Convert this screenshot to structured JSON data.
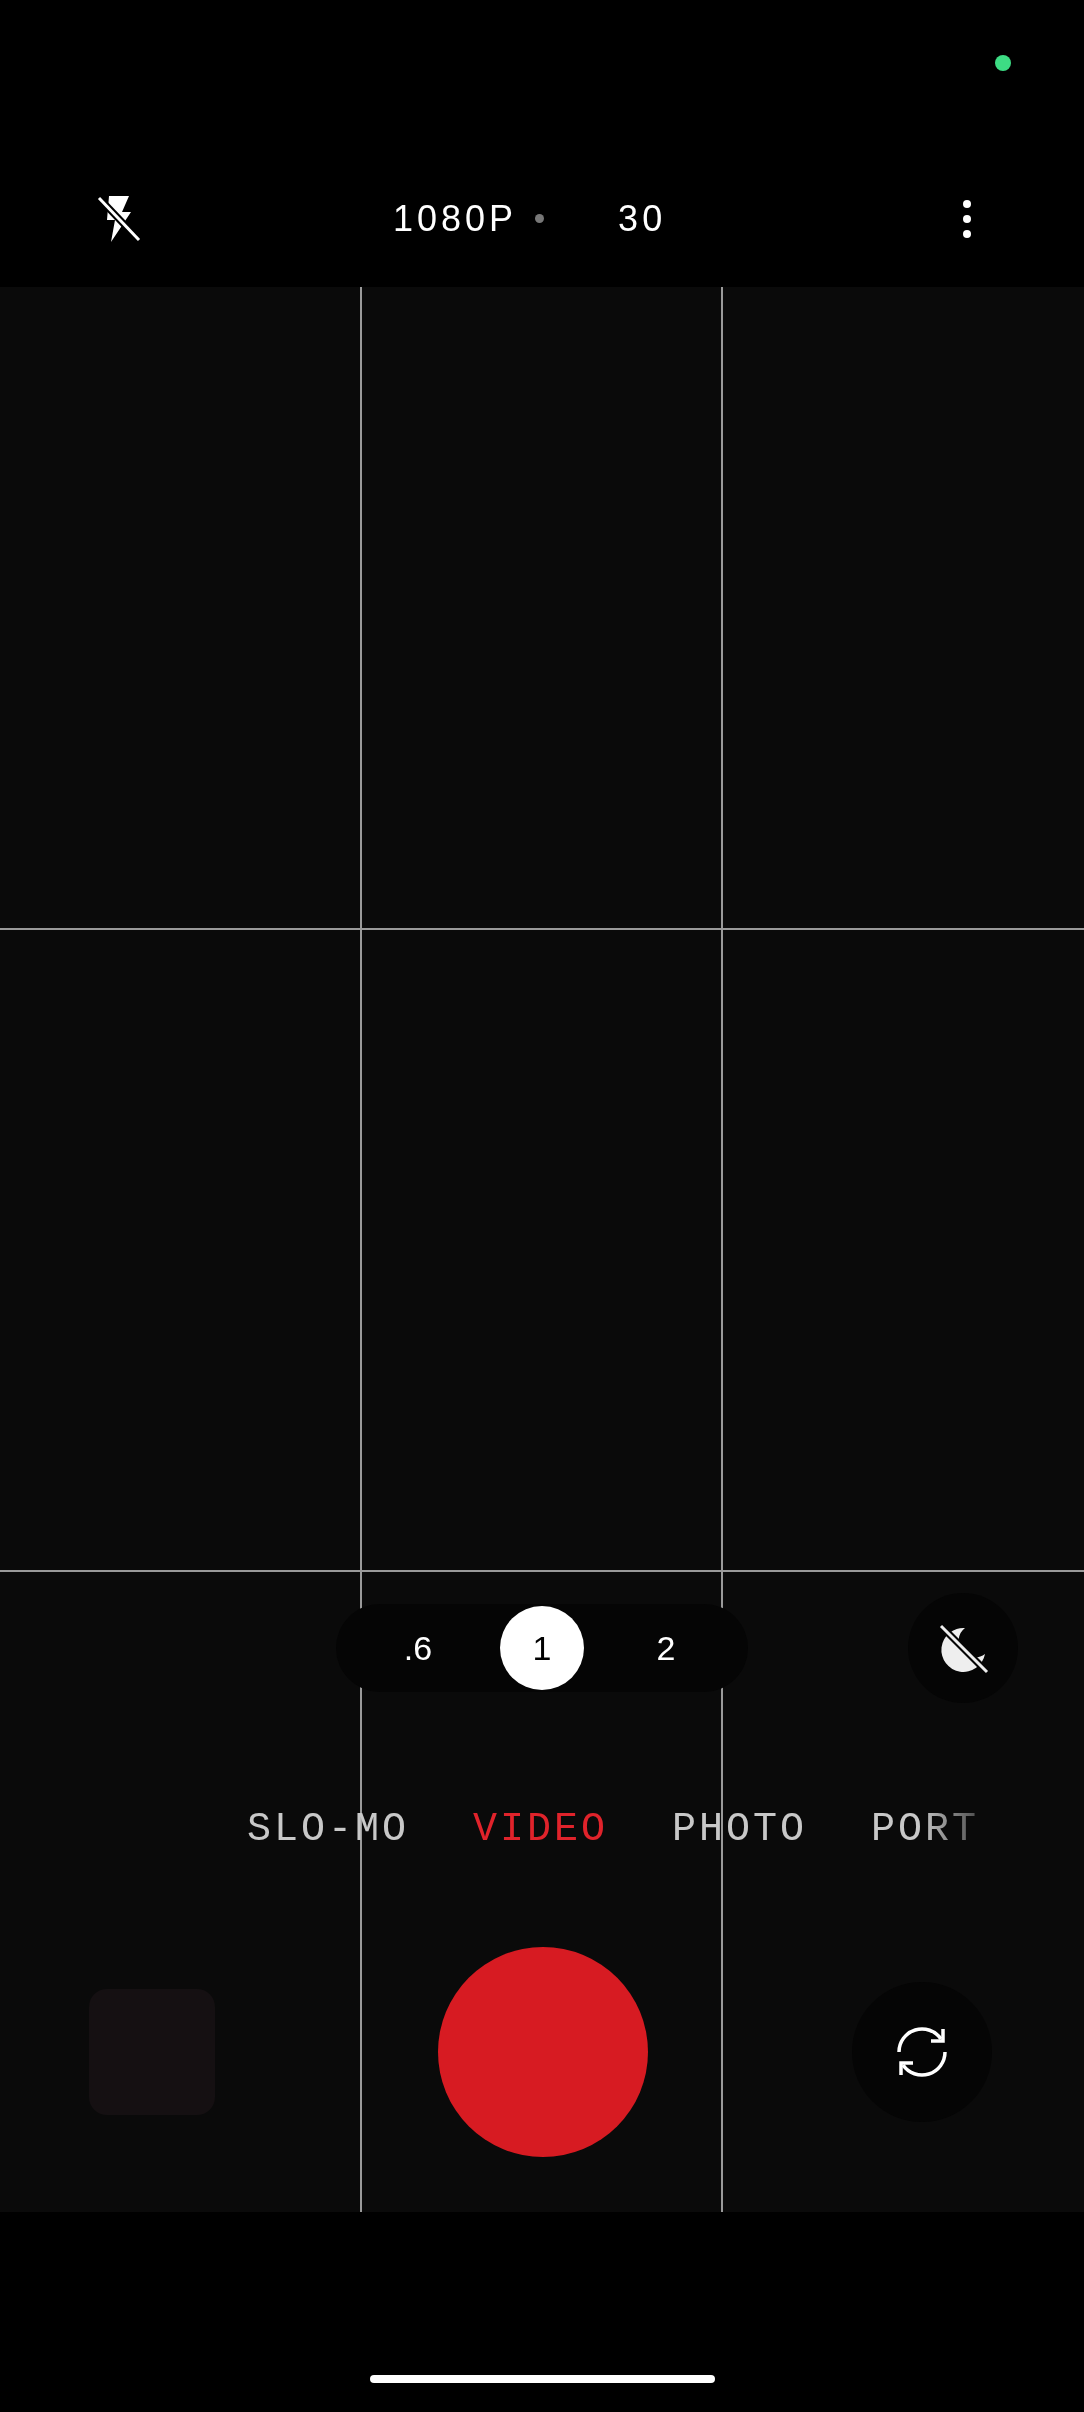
{
  "top_bar": {
    "flash": {
      "on": false
    },
    "resolution": "1080P",
    "frame_rate": "30"
  },
  "zoom_levels": [
    {
      "label": ".6",
      "selected": false
    },
    {
      "label": "1",
      "selected": true
    },
    {
      "label": "2",
      "selected": false
    }
  ],
  "night_mode": {
    "on": false
  },
  "modes": [
    {
      "label": "SLO-MO",
      "selected": false
    },
    {
      "label": "VIDEO",
      "selected": true
    },
    {
      "label": "PHOTO",
      "selected": false
    },
    {
      "label": "PORT",
      "selected": false
    }
  ]
}
